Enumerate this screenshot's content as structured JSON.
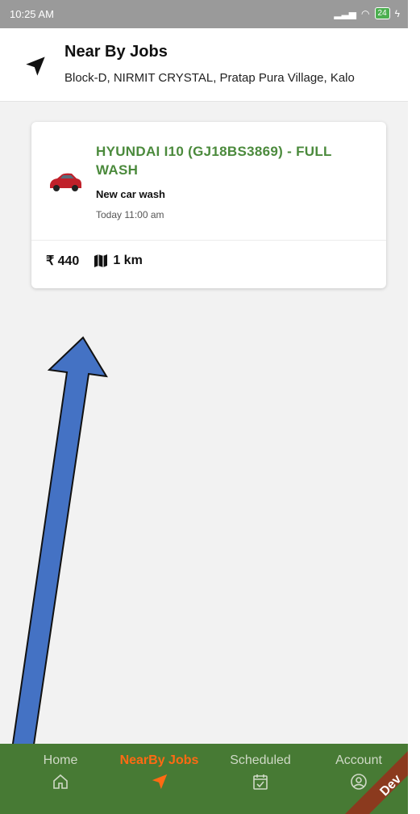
{
  "status_bar": {
    "time": "10:25 AM",
    "battery": "24"
  },
  "header": {
    "title": "Near By Jobs",
    "address": "Block-D, NIRMIT CRYSTAL, Pratap Pura Village, Kalo",
    "icon": "navigation-arrow-icon"
  },
  "job_card": {
    "title": "HYUNDAI I10 (GJ18BS3869) - FULL WASH",
    "service": "New car wash",
    "time": "Today 11:00 am",
    "price": "₹ 440",
    "distance": "1 km",
    "icons": [
      "car-icon",
      "map-icon"
    ]
  },
  "bottom_nav": {
    "tabs": [
      {
        "label": "Home",
        "icon": "home-icon",
        "active": false
      },
      {
        "label": "NearBy Jobs",
        "icon": "navigation-arrow-icon",
        "active": true
      },
      {
        "label": "Scheduled",
        "icon": "calendar-check-icon",
        "active": false
      },
      {
        "label": "Account",
        "icon": "account-icon",
        "active": false
      }
    ],
    "ribbon": "Dev"
  },
  "colors": {
    "nav_bg": "#477a34",
    "active_tab": "#ff6a13",
    "job_title": "#4b8a3c",
    "annotation_arrow": "#4472c4",
    "ribbon": "#8b3a1e"
  }
}
